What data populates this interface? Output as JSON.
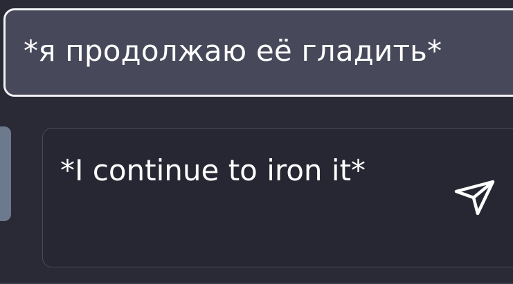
{
  "chat": {
    "message": "*я продолжаю её гладить*"
  },
  "composer": {
    "input_text": "*I continue to iron it*",
    "send_icon": "send-icon"
  },
  "colors": {
    "background": "#292a36",
    "bubble_fill": "#474859",
    "bubble_border": "#f3f3f6",
    "input_fill": "#262732",
    "handle": "#6d7a8d",
    "text": "#ffffff"
  }
}
